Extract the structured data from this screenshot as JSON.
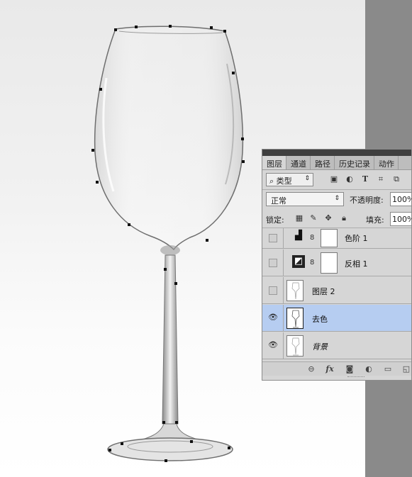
{
  "panel": {
    "tabs": [
      "图层",
      "通道",
      "路径",
      "历史记录",
      "动作"
    ],
    "active_tab": "图层",
    "filter_kind": "⌕ 类型",
    "filter_icons": [
      "image-filter-icon",
      "adjustment-filter-icon",
      "type-filter-icon",
      "shape-filter-icon",
      "smart-object-filter-icon"
    ],
    "blend_mode": "正常",
    "opacity_label": "不透明度:",
    "opacity_value": "100%",
    "lock_label": "锁定:",
    "lock_icons": [
      "lock-transparent-icon",
      "lock-image-icon",
      "lock-position-icon",
      "lock-all-icon"
    ],
    "fill_label": "填充:",
    "fill_value": "100%",
    "layers": [
      {
        "name": "色阶 1",
        "type": "adjustment",
        "icon": "levels-icon",
        "visible": false,
        "selected": false
      },
      {
        "name": "反相 1",
        "type": "adjustment",
        "icon": "invert-icon",
        "visible": false,
        "selected": false
      },
      {
        "name": "图层 2",
        "type": "pixel",
        "visible": false,
        "selected": false
      },
      {
        "name": "去色",
        "type": "pixel",
        "visible": true,
        "selected": true
      },
      {
        "name": "背景",
        "type": "pixel",
        "visible": true,
        "selected": false,
        "italic": true
      }
    ],
    "footer_icons": [
      "link-layers-icon",
      "fx-icon",
      "add-mask-icon",
      "new-adjustment-icon",
      "new-group-icon",
      "new-layer-icon"
    ],
    "footer_fx": "fx"
  },
  "colors": {
    "panel_bg": "#d6d6d6",
    "selected_layer": "#b6cdf1",
    "margin_gray": "#8a8a8a",
    "path_anchor": "#111111"
  }
}
